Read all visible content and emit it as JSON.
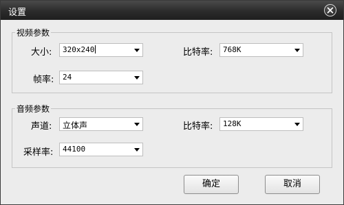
{
  "window": {
    "title": "设置"
  },
  "video": {
    "legend": "视频参数",
    "size_label": "大小:",
    "size_value": "320x240",
    "bitrate_label": "比特率:",
    "bitrate_value": "768K",
    "framerate_label": "帧率:",
    "framerate_value": "24"
  },
  "audio": {
    "legend": "音频参数",
    "channel_label": "声道:",
    "channel_value": "立体声",
    "bitrate_label": "比特率:",
    "bitrate_value": "128K",
    "samplerate_label": "采样率:",
    "samplerate_value": "44100"
  },
  "buttons": {
    "ok_label": "确定",
    "cancel_label": "取消"
  },
  "icons": {
    "close": "close-icon",
    "dropdown": "chevron-down-icon"
  }
}
